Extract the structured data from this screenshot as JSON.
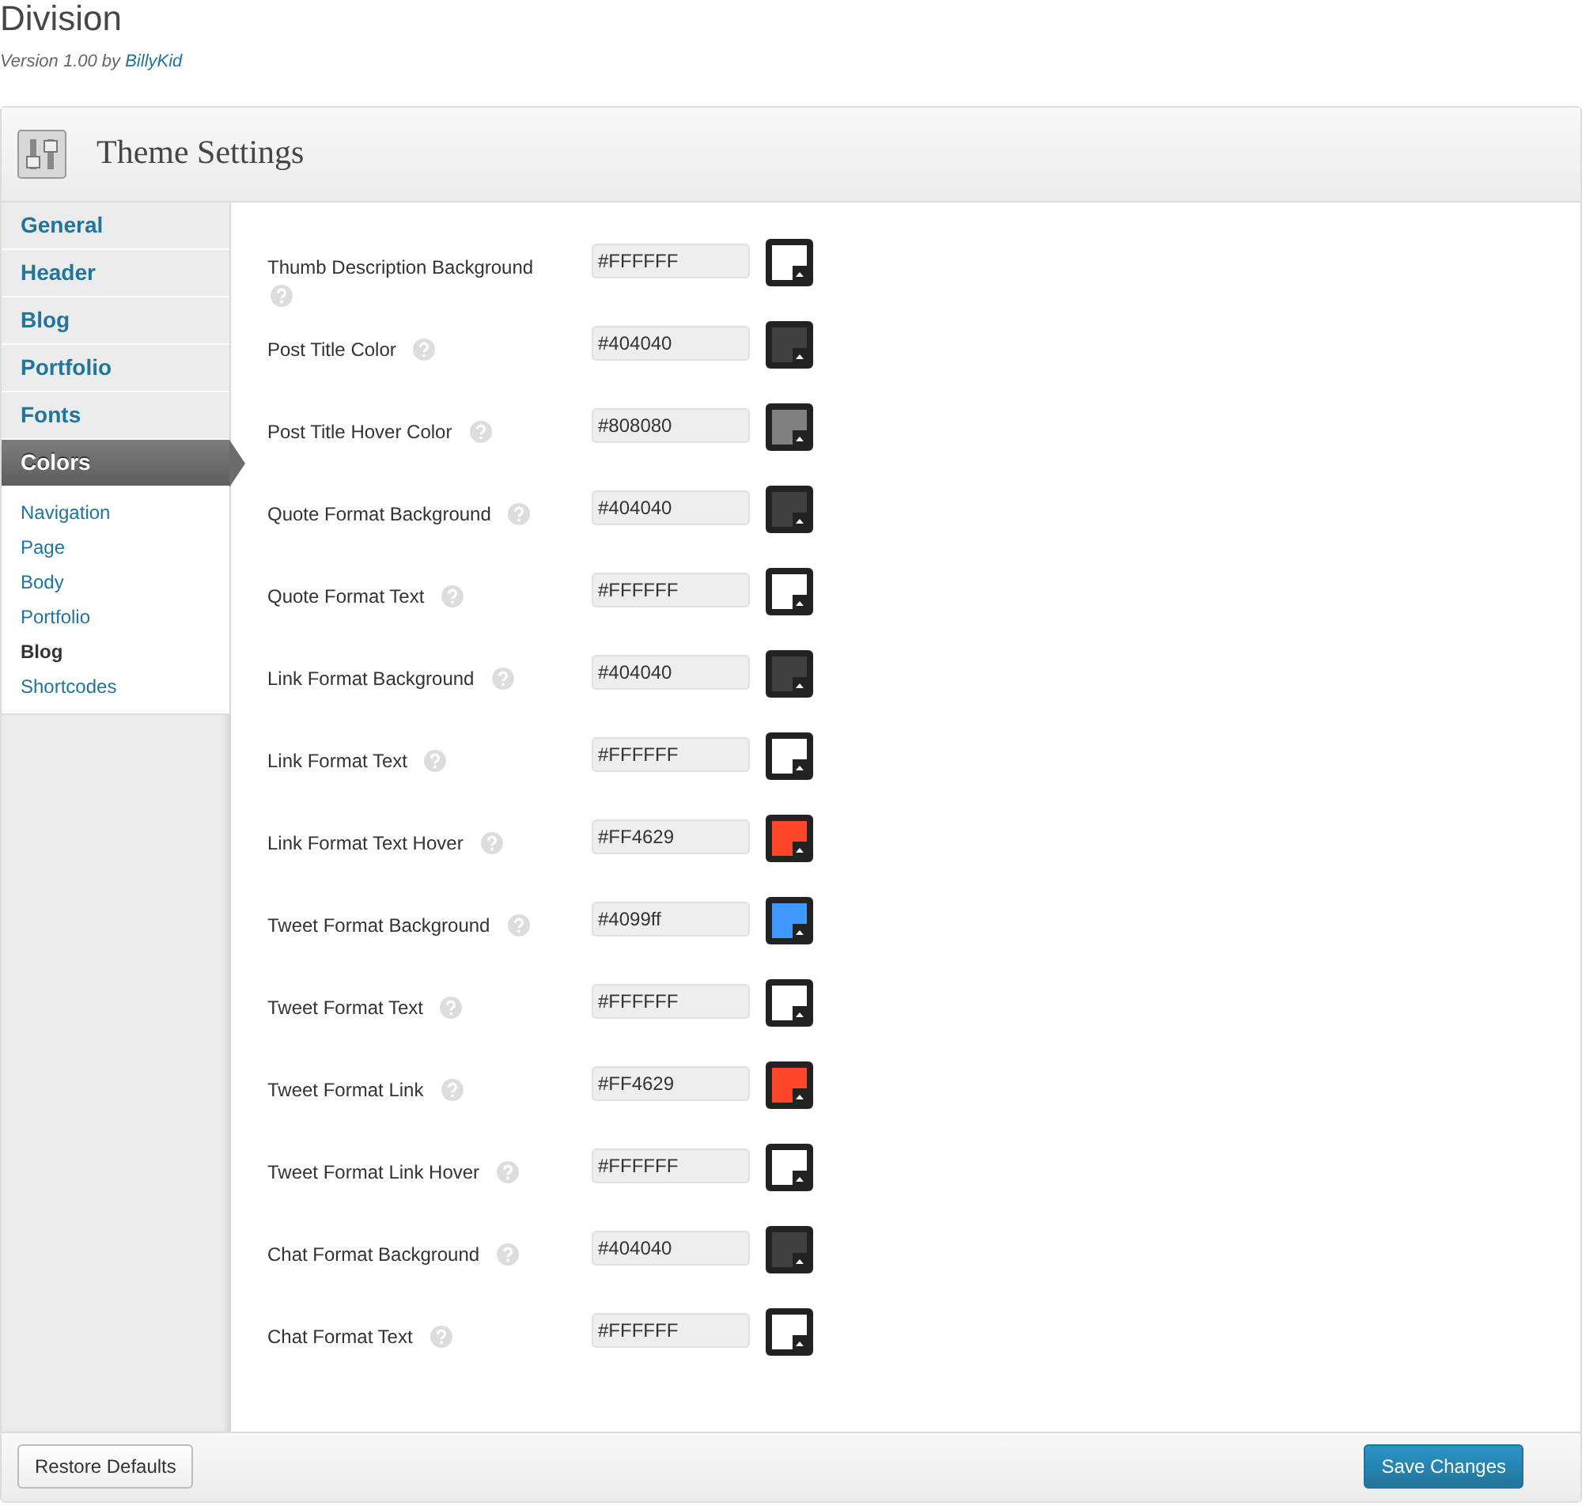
{
  "page": {
    "title": "Division",
    "version": "Version 1.00 by ",
    "author": "BillyKid"
  },
  "panel": {
    "title": "Theme Settings"
  },
  "sidebar": {
    "tabs": [
      {
        "label": "General",
        "selected": false
      },
      {
        "label": "Header",
        "selected": false
      },
      {
        "label": "Blog",
        "selected": false
      },
      {
        "label": "Portfolio",
        "selected": false
      },
      {
        "label": "Fonts",
        "selected": false
      },
      {
        "label": "Colors",
        "selected": true
      }
    ],
    "subitems": [
      {
        "label": "Navigation",
        "selected": false
      },
      {
        "label": "Page",
        "selected": false
      },
      {
        "label": "Body",
        "selected": false
      },
      {
        "label": "Portfolio",
        "selected": false
      },
      {
        "label": "Blog",
        "selected": true
      },
      {
        "label": "Shortcodes",
        "selected": false
      }
    ]
  },
  "settings": [
    {
      "label": "Thumb Description Background",
      "value": "#FFFFFF"
    },
    {
      "label": "Post Title Color",
      "value": "#404040"
    },
    {
      "label": "Post Title Hover Color",
      "value": "#808080"
    },
    {
      "label": "Quote Format Background",
      "value": "#404040"
    },
    {
      "label": "Quote Format Text",
      "value": "#FFFFFF"
    },
    {
      "label": "Link Format Background",
      "value": "#404040"
    },
    {
      "label": "Link Format Text",
      "value": "#FFFFFF"
    },
    {
      "label": "Link Format Text Hover",
      "value": "#FF4629"
    },
    {
      "label": "Tweet Format Background",
      "value": "#4099ff"
    },
    {
      "label": "Tweet Format Text",
      "value": "#FFFFFF"
    },
    {
      "label": "Tweet Format Link",
      "value": "#FF4629"
    },
    {
      "label": "Tweet Format Link Hover",
      "value": "#FFFFFF"
    },
    {
      "label": "Chat Format Background",
      "value": "#404040"
    },
    {
      "label": "Chat Format Text",
      "value": "#FFFFFF"
    }
  ],
  "footer": {
    "reset": "Restore Defaults",
    "save": "Save Changes"
  }
}
